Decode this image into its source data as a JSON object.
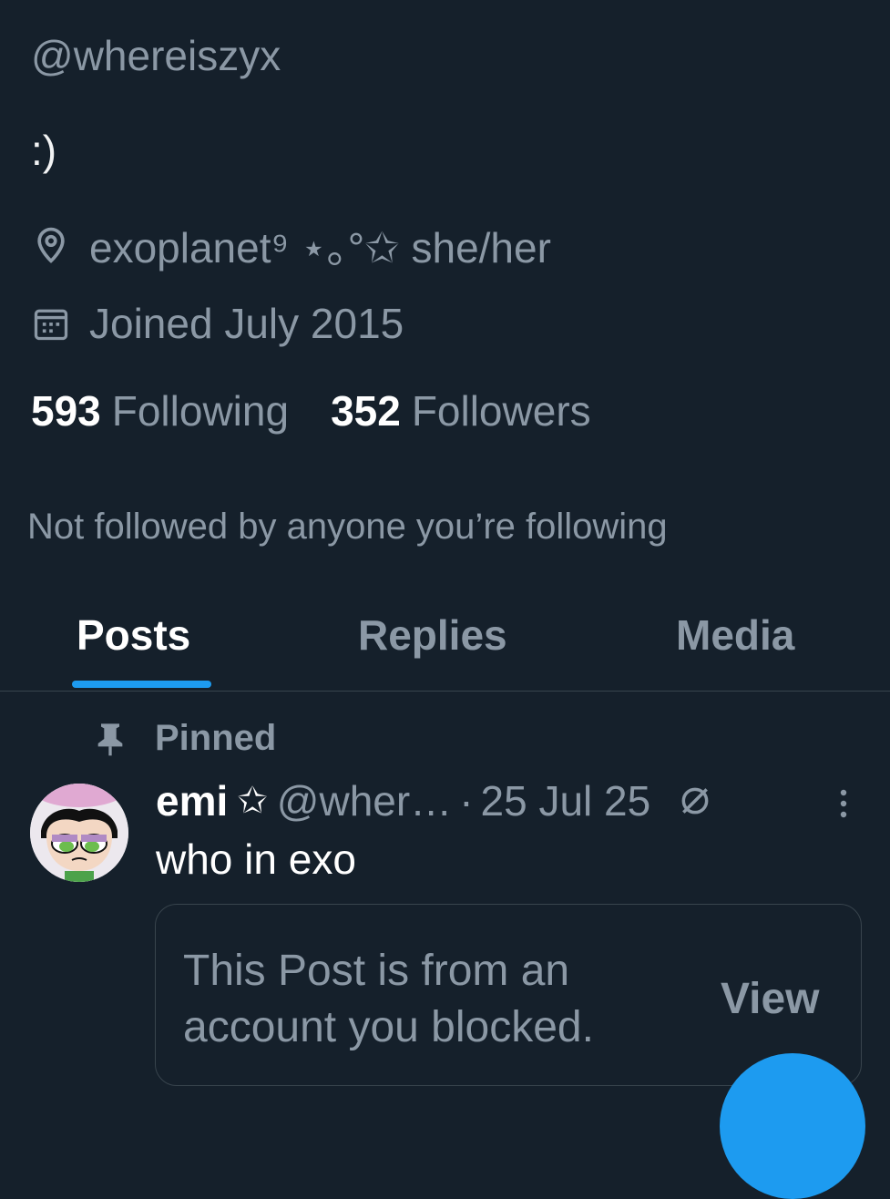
{
  "profile": {
    "handle": "@whereiszyx",
    "bio": ":)",
    "location": "exoplanet⁹ ⋆｡°✩ she/her",
    "joined": "Joined July 2015",
    "following_count": "593",
    "following_label": "Following",
    "followers_count": "352",
    "followers_label": "Followers",
    "mutuals_note": "Not followed by anyone you’re following"
  },
  "tabs": [
    {
      "label": "Posts",
      "active": true
    },
    {
      "label": "Replies",
      "active": false
    },
    {
      "label": "Media",
      "active": false
    }
  ],
  "post": {
    "pinned_label": "Pinned",
    "display_name": "emi",
    "name_badge": "✩",
    "handle": "@wher…",
    "separator": "·",
    "date": "25 Jul 25",
    "text": "who in exo",
    "quote": {
      "blocked_text": "This Post is from an account you blocked.",
      "view_label": "View"
    }
  },
  "icons": {
    "location": "location-pin-icon",
    "calendar": "calendar-icon",
    "pin": "pin-icon",
    "edited": "edited-icon",
    "more": "more-vertical-icon"
  },
  "colors": {
    "background": "#15202b",
    "accent": "#1d9bf0",
    "muted_text": "#8b98a5",
    "border": "#38444d"
  }
}
